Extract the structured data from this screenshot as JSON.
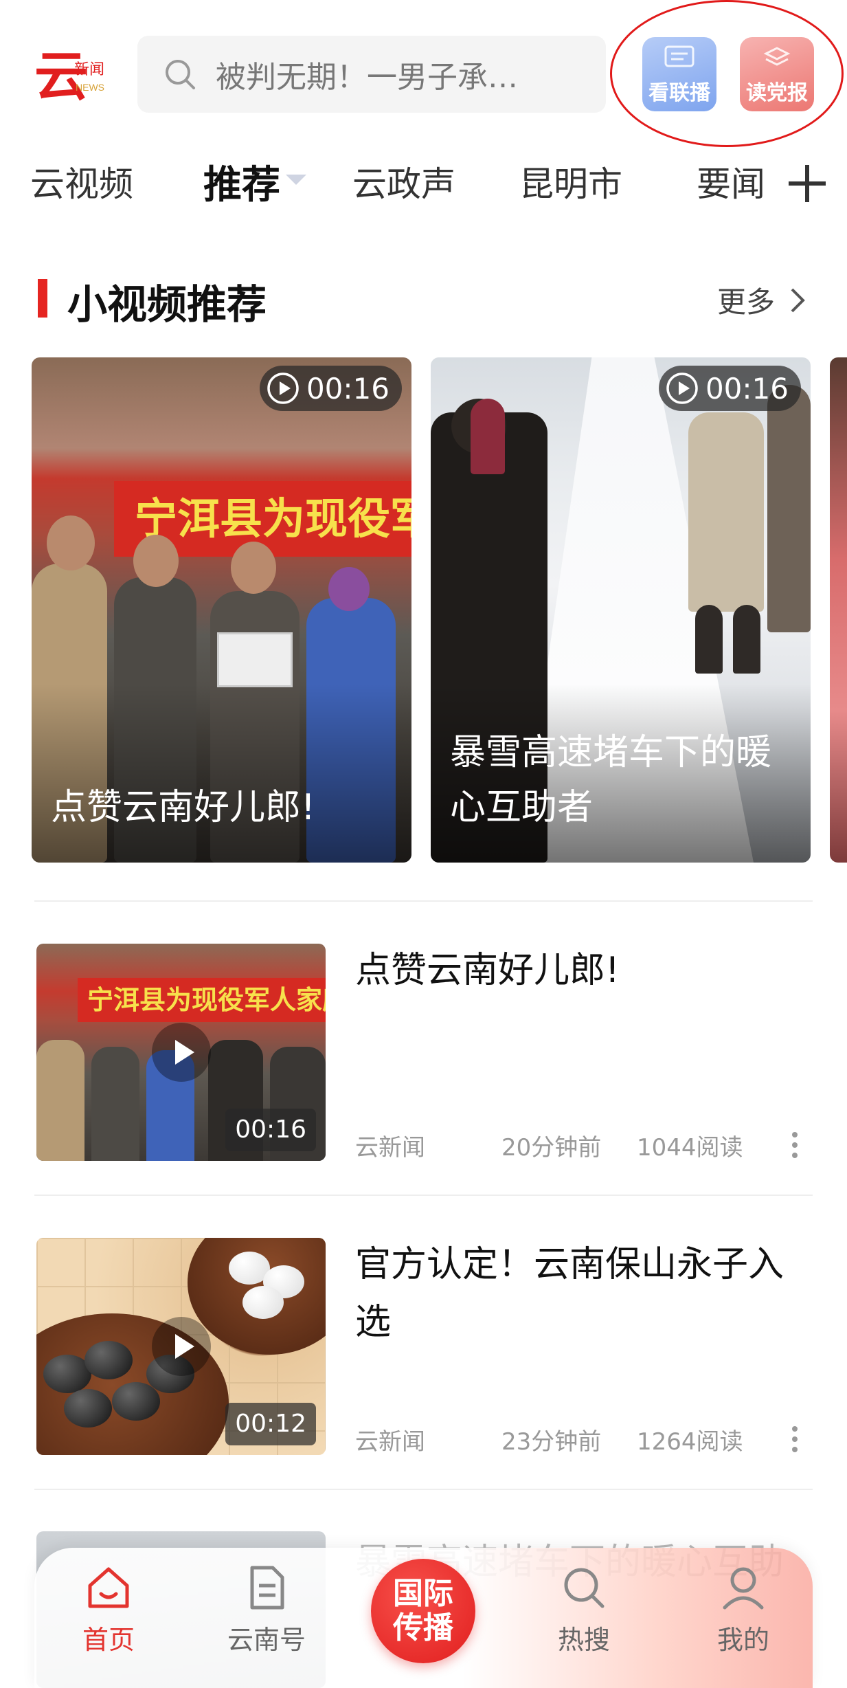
{
  "header": {
    "logo_text": "云新闻 NEWS",
    "search_placeholder": "被判无期！一男子承…",
    "buttons": [
      {
        "label": "看联播",
        "icon": "news-broadcast-icon",
        "color": "#7ea4ee"
      },
      {
        "label": "读党报",
        "icon": "party-paper-icon",
        "color": "#ec7772"
      }
    ],
    "annotation_color": "#e11a1a"
  },
  "tabs": [
    {
      "label": "云视频"
    },
    {
      "label": "推荐",
      "active": true
    },
    {
      "label": "云政声"
    },
    {
      "label": "昆明市"
    },
    {
      "label": "要闻"
    }
  ],
  "section": {
    "title": "小视频推荐",
    "more_label": "更多",
    "accent": "#e52521"
  },
  "video_cards": [
    {
      "duration": "00:16",
      "title": "点赞云南好儿郎!",
      "banner": "宁洱县为现役军"
    },
    {
      "duration": "00:16",
      "title": "暴雪高速堵车下的暖心互助者"
    }
  ],
  "articles": [
    {
      "title": "点赞云南好儿郎!",
      "source": "云新闻",
      "time": "20分钟前",
      "reads": "1044阅读",
      "duration": "00:16",
      "thumb_banner": "宁洱县为现役军人家庭"
    },
    {
      "title": "官方认定！云南保山永子入选",
      "source": "云新闻",
      "time": "23分钟前",
      "reads": "1264阅读",
      "duration": "00:12"
    },
    {
      "title": "暴雪高速堵车下的暖心互助"
    }
  ],
  "bottom_nav": {
    "items": [
      {
        "label": "首页",
        "icon": "home-icon",
        "active": true
      },
      {
        "label": "云南号",
        "icon": "document-icon"
      },
      {
        "label": "热搜",
        "icon": "search-icon"
      },
      {
        "label": "我的",
        "icon": "profile-icon"
      }
    ],
    "center_label_line1": "国际",
    "center_label_line2": "传播",
    "active_color": "#e3342f"
  }
}
